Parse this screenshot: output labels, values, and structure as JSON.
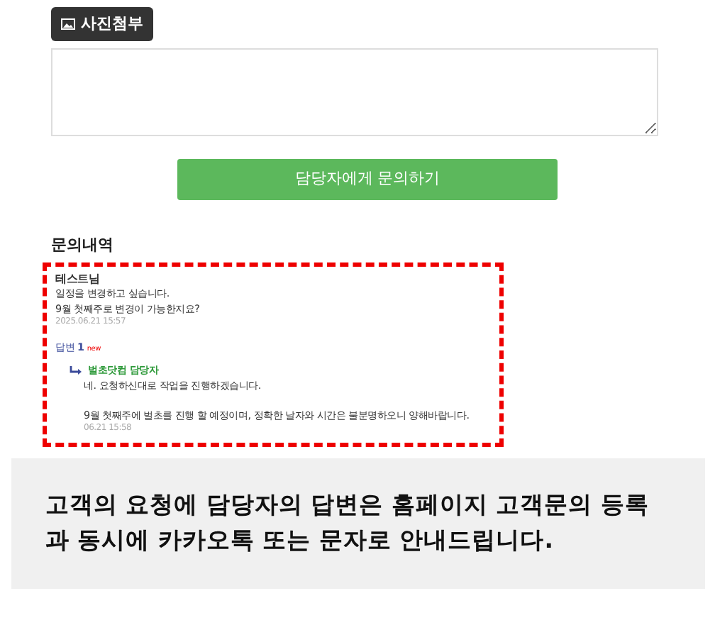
{
  "attach_button": {
    "label": "사진첨부"
  },
  "submit_button": {
    "label": "담당자에게 문의하기"
  },
  "history": {
    "title": "문의내역",
    "question": {
      "author": "테스트님",
      "lines": [
        "일정을 변경하고 싶습니다.",
        "9월 첫째주로 변경이 가능한지요?"
      ],
      "time": "2025.06.21 15:57"
    },
    "answer_count": {
      "label": "답변",
      "count": "1",
      "badge": "new"
    },
    "answer": {
      "author": "벌초닷컴 담당자",
      "lines": [
        "네. 요청하신대로 작업을 진행하겠습니다.",
        "9월 첫째주에 벌초를 진행 할 예정이며, 정확한 날자와 시간은 불분명하오니 양해바랍니다."
      ],
      "time": "06.21 15:58"
    }
  },
  "caption": "고객의 요청에 담당자의 답변은 홈페이지 고객문의 등록과 동시에 카카오톡 또는 문자로 안내드립니다."
}
